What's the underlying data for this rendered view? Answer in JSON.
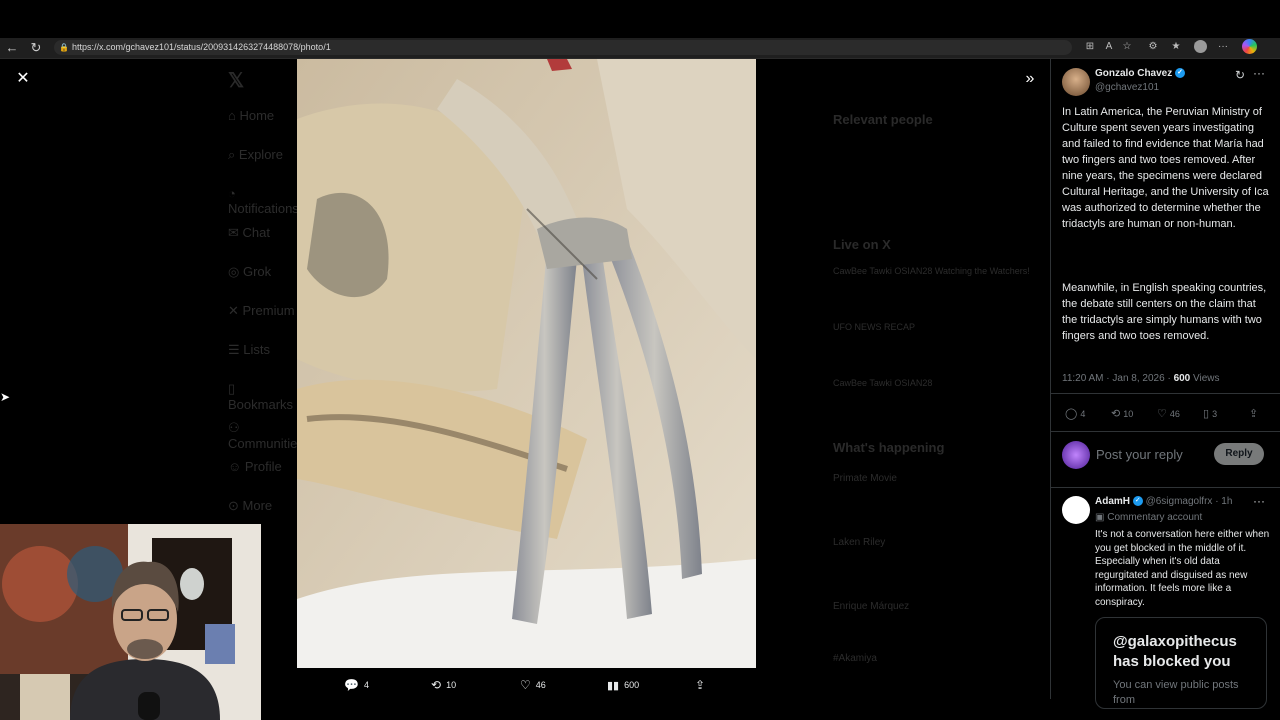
{
  "browser": {
    "url": "https://x.com/gchavez101/status/2009314263274488078/photo/1"
  },
  "background": {
    "nav_items": [
      "Home",
      "Explore",
      "Notifications",
      "Chat",
      "Grok",
      "Premium",
      "Lists",
      "Bookmarks",
      "Communities",
      "Profile",
      "More"
    ],
    "relevant_people_header": "Relevant people",
    "live_header": "Live on X",
    "live_items": [
      "CawBee Tawki OSIAN28 Watching the Watchers!",
      "UFO NEWS RECAP",
      "CawBee Tawki OSIAN28"
    ],
    "happening_header": "What's happening",
    "happening_items": [
      "Primate Movie",
      "Laken Riley",
      "Enrique Márquez",
      "#Akamiya"
    ]
  },
  "photo_actions": {
    "replies": "4",
    "reposts": "10",
    "likes": "46",
    "views": "600"
  },
  "post": {
    "author_name": "Gonzalo Chavez",
    "author_handle": "@gchavez101",
    "paragraph1": "In Latin America, the Peruvian Ministry of Culture spent seven years investigating and failed to find evidence that María had two fingers and two toes removed. After nine years, the specimens were declared Cultural Heritage, and the University of Ica was authorized to determine whether the tridactyls are human or non-human.",
    "paragraph2": "Meanwhile, in English speaking countries, the debate still centers on the claim that the tridactyls are simply humans with two fingers and two toes removed.",
    "timestamp": "11:20 AM · Jan 8, 2026 · ",
    "views_count": "600",
    "views_label": " Views",
    "replies": "4",
    "reposts": "10",
    "likes": "46",
    "bookmarks": "3"
  },
  "reply_box": {
    "placeholder": "Post your reply",
    "button": "Reply"
  },
  "reply": {
    "author_name": "AdamH",
    "author_handle": "@6sigmagolfrx",
    "age": "· 1h",
    "badge": "Commentary account",
    "text": "It's not a conversation here either when you get blocked in the middle of it. Especially when it's old data regurgitated and disguised as new information. It feels more like a conspiracy.",
    "blocked_title": "@galaxopithecus has blocked you",
    "blocked_sub": "You can view public posts from"
  },
  "colors": {
    "accent": "#1d9bf0",
    "panel_bg": "#000000",
    "muted": "#71767b"
  }
}
